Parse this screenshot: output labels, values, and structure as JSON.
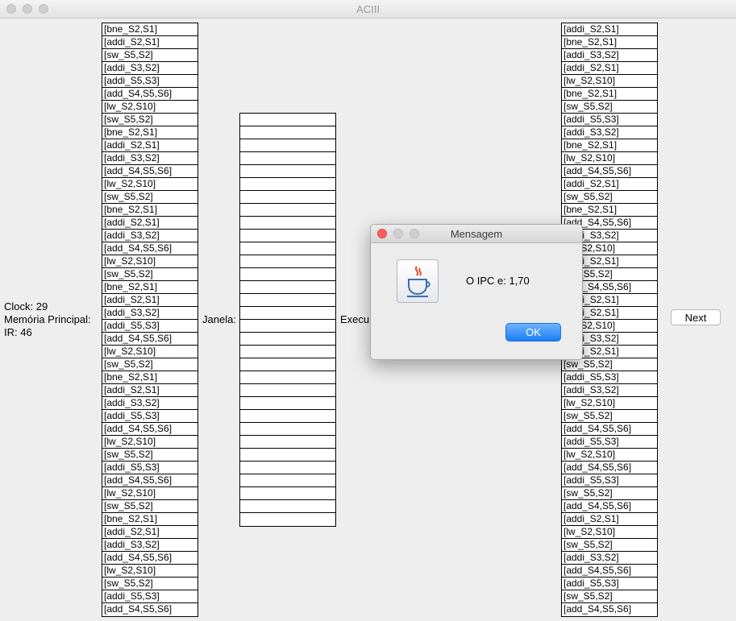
{
  "window": {
    "title": "ACIII"
  },
  "labels": {
    "clock": "Clock: 29",
    "memoria": "Memória Principal:",
    "ir": "IR: 46",
    "janela": "Janela:",
    "execucao": "Execu"
  },
  "memoria_principal": [
    "[bne_S2,S1]",
    "[addi_S2,S1]",
    "[sw_S5,S2]",
    "[addi_S3,S2]",
    "[addi_S5,S3]",
    "[add_S4,S5,S6]",
    "[lw_S2,S10]",
    "[sw_S5,S2]",
    "[bne_S2,S1]",
    "[addi_S2,S1]",
    "[addi_S3,S2]",
    "[add_S4,S5,S6]",
    "[lw_S2,S10]",
    "[sw_S5,S2]",
    "[bne_S2,S1]",
    "[addi_S2,S1]",
    "[addi_S3,S2]",
    "[add_S4,S5,S6]",
    "[lw_S2,S10]",
    "[sw_S5,S2]",
    "[bne_S2,S1]",
    "[addi_S2,S1]",
    "[addi_S3,S2]",
    "[addi_S5,S3]",
    "[add_S4,S5,S6]",
    "[lw_S2,S10]",
    "[sw_S5,S2]",
    "[bne_S2,S1]",
    "[addi_S2,S1]",
    "[addi_S3,S2]",
    "[addi_S5,S3]",
    "[add_S4,S5,S6]",
    "[lw_S2,S10]",
    "[sw_S5,S2]",
    "[addi_S5,S3]",
    "[add_S4,S5,S6]",
    "[lw_S2,S10]",
    "[sw_S5,S2]",
    "[bne_S2,S1]",
    "[addi_S2,S1]",
    "[addi_S3,S2]",
    "[add_S4,S5,S6]",
    "[lw_S2,S10]",
    "[sw_S5,S2]",
    "[addi_S5,S3]",
    "[add_S4,S5,S6]"
  ],
  "janela_slots": 32,
  "execucao": [
    "[addi_S2,S1]",
    "[bne_S2,S1]",
    "[addi_S3,S2]",
    "[addi_S2,S1]",
    "[lw_S2,S10]",
    "[bne_S2,S1]",
    "[sw_S5,S2]",
    "[addi_S5,S3]",
    "[addi_S3,S2]",
    "[bne_S2,S1]",
    "[lw_S2,S10]",
    "[add_S4,S5,S6]",
    "[addi_S2,S1]",
    "[sw_S5,S2]",
    "[bne_S2,S1]",
    "[add_S4,S5,S6]",
    "[addi_S3,S2]",
    "[lw_S2,S10]",
    "[addi_S2,S1]",
    "[sw_S5,S2]",
    "[add_S4,S5,S6]",
    "[addi_S2,S1]",
    "[addi_S2,S1]",
    "[lw_S2,S10]",
    "[addi_S3,S2]",
    "[addi_S2,S1]",
    "[sw_S5,S2]",
    "[addi_S5,S3]",
    "[addi_S3,S2]",
    "[lw_S2,S10]",
    "[sw_S5,S2]",
    "[add_S4,S5,S6]",
    "[addi_S5,S3]",
    "[lw_S2,S10]",
    "[add_S4,S5,S6]",
    "[addi_S5,S3]",
    "[sw_S5,S2]",
    "[add_S4,S5,S6]",
    "[addi_S2,S1]",
    "[lw_S2,S10]",
    "[sw_S5,S2]",
    "[addi_S3,S2]",
    "[add_S4,S5,S6]",
    "[addi_S5,S3]",
    "[sw_S5,S2]",
    "[add_S4,S5,S6]"
  ],
  "buttons": {
    "next": "Next"
  },
  "dialog": {
    "title": "Mensagem",
    "message": "O IPC e: 1,70",
    "ok": "OK",
    "icon": "java-cup-icon"
  },
  "colors": {
    "close": "#fc605b",
    "minimize": "#d0d0d0",
    "zoom": "#d0d0d0",
    "ok_button": "#1b7ef5"
  }
}
